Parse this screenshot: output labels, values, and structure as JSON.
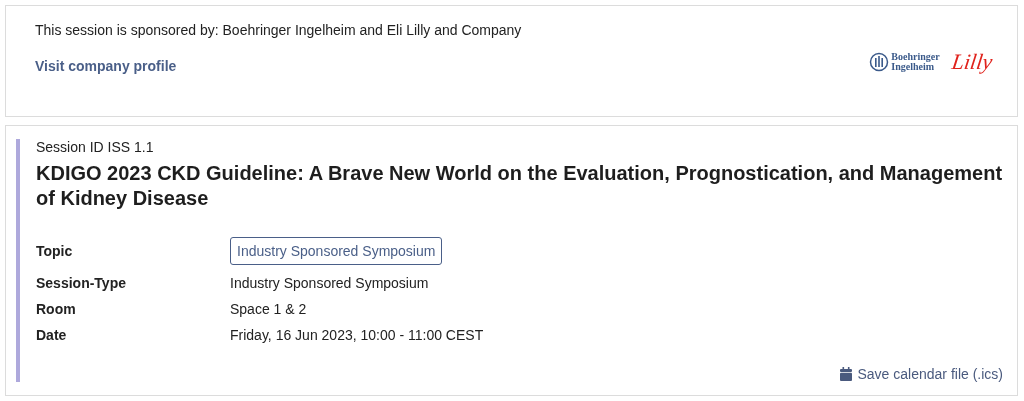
{
  "sponsor": {
    "text": "This session is sponsored by: Boehringer Ingelheim and Eli Lilly and Company",
    "link": "Visit company profile",
    "logos": [
      {
        "kind": "boehringer",
        "lines": [
          "Boehringer",
          "Ingelheim"
        ]
      },
      {
        "kind": "lilly",
        "lines": [
          "Lilly"
        ]
      }
    ]
  },
  "session": {
    "id": "Session ID ISS 1.1",
    "title": "KDIGO 2023 CKD Guideline: A Brave New World on the Evaluation, Prognostication, and Management of Kidney Disease",
    "details": [
      {
        "label": "Topic",
        "value": "Industry Sponsored Symposium",
        "kind": "tag"
      },
      {
        "label": "Session-Type",
        "value": "Industry Sponsored Symposium",
        "kind": "text"
      },
      {
        "label": "Room",
        "value": "Space 1 & 2",
        "kind": "text"
      },
      {
        "label": "Date",
        "value": "Friday, 16 Jun 2023, 10:00 - 11:00 CEST",
        "kind": "text"
      }
    ],
    "calendar_link": "Save calendar file (.ics)"
  }
}
